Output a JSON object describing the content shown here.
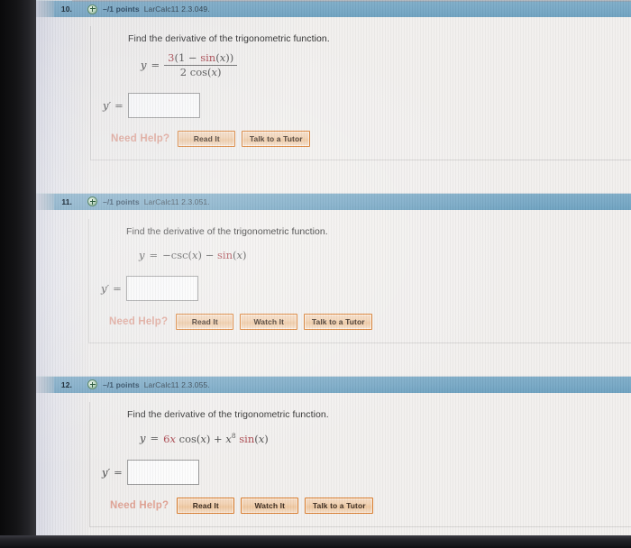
{
  "page": {
    "questions": [
      {
        "number": "10.",
        "points": "–/1 points",
        "reference": "LarCalc11 2.3.049.",
        "plus_icon": "plus-circle-icon",
        "prompt": "Find the derivative of the trigonometric function.",
        "equation": {
          "type": "fraction",
          "lhs": "y",
          "equals": "=",
          "numerator": "3(1 − sin(x))",
          "denominator": "2 cos(x)",
          "numerator_parts": [
            {
              "text": "3",
              "color": "red"
            },
            {
              "text": "(1 ",
              "color": "grey"
            },
            {
              "text": "− ",
              "color": "grey"
            },
            {
              "text": "sin",
              "color": "red"
            },
            {
              "text": "(x))",
              "color": "grey"
            }
          ],
          "denominator_parts": [
            {
              "text": "2 ",
              "color": "grey"
            },
            {
              "text": "cos",
              "color": "grey"
            },
            {
              "text": "(x)",
              "color": "grey"
            }
          ]
        },
        "answer": {
          "label": "y′",
          "equals": "=",
          "value": "",
          "placeholder": ""
        },
        "help": {
          "label": "Need Help?",
          "buttons": [
            "Read It",
            "Talk to a Tutor"
          ]
        }
      },
      {
        "number": "11.",
        "points": "–/1 points",
        "reference": "LarCalc11 2.3.051.",
        "plus_icon": "plus-circle-icon",
        "prompt": "Find the derivative of the trigonometric function.",
        "equation": {
          "type": "inline",
          "lhs": "y",
          "equals": "=",
          "rhs": "−csc(x) − sin(x)",
          "parts": [
            {
              "text": "−csc",
              "color": "grey"
            },
            {
              "text": "(x) ",
              "color": "grey"
            },
            {
              "text": "− ",
              "color": "grey"
            },
            {
              "text": "sin",
              "color": "red"
            },
            {
              "text": "(x)",
              "color": "grey"
            }
          ]
        },
        "answer": {
          "label": "y′",
          "equals": "=",
          "value": "",
          "placeholder": ""
        },
        "help": {
          "label": "Need Help?",
          "buttons": [
            "Read It",
            "Watch It",
            "Talk to a Tutor"
          ]
        }
      },
      {
        "number": "12.",
        "points": "–/1 points",
        "reference": "LarCalc11 2.3.055.",
        "plus_icon": "plus-circle-icon",
        "prompt": "Find the derivative of the trigonometric function.",
        "equation": {
          "type": "inline",
          "lhs": "y",
          "equals": "=",
          "rhs": "6x cos(x) + x⁸ sin(x)",
          "parts": [
            {
              "text": "6x ",
              "color": "red"
            },
            {
              "text": "cos",
              "color": "grey"
            },
            {
              "text": "(x) + ",
              "color": "grey"
            },
            {
              "text": "x",
              "color": "grey"
            },
            {
              "text": "8",
              "color": "grey",
              "sup": true
            },
            {
              "text": " sin",
              "color": "red"
            },
            {
              "text": "(x)",
              "color": "grey"
            }
          ]
        },
        "answer": {
          "label": "y′",
          "equals": "=",
          "value": "",
          "placeholder": ""
        },
        "help": {
          "label": "Need Help?",
          "buttons": [
            "Read It",
            "Watch It",
            "Talk to a Tutor"
          ]
        }
      }
    ]
  },
  "colors": {
    "header_blue": "#79a9c6",
    "page_background": "#f2f0ee",
    "need_help_text": "#e1a293",
    "button_border": "#d97a28",
    "math_red": "#a8424a",
    "math_grey": "#4a4a4a",
    "bezel_dark": "#141416"
  }
}
